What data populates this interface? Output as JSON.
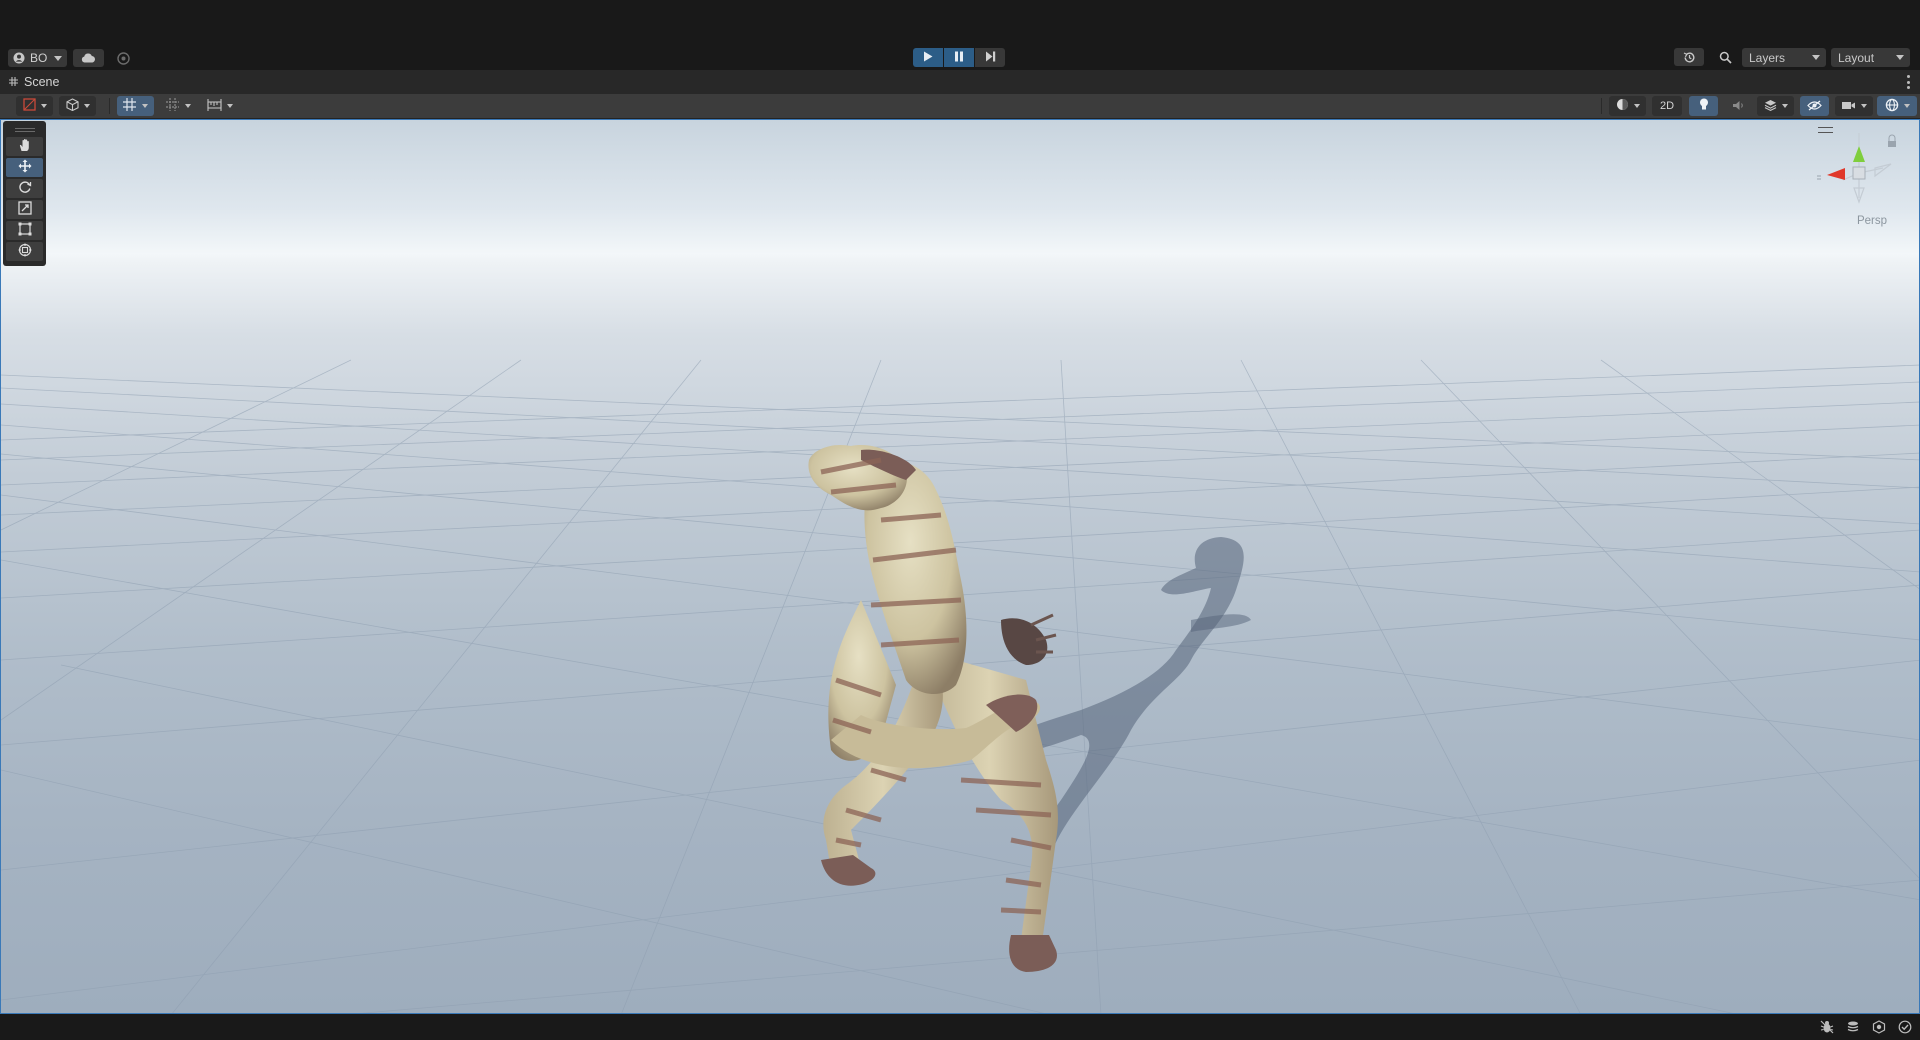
{
  "toolbar": {
    "account_label": "BO",
    "layers_label": "Layers",
    "layout_label": "Layout",
    "play_state": "playing"
  },
  "scene": {
    "tab_label": "Scene",
    "mode_2d_label": "2D",
    "camera_label": "Persp"
  },
  "icons": [
    "user-icon",
    "cloud-icon",
    "collab-icon",
    "play-icon",
    "pause-icon",
    "step-icon",
    "history-icon",
    "search-icon",
    "hand-icon",
    "move-icon",
    "rotate-icon",
    "scale-icon",
    "rect-icon",
    "transform-icon",
    "gizmo-icon",
    "bug-icon",
    "stack-icon",
    "globe-icon",
    "check-icon"
  ],
  "colors": {
    "accent": "#46607c",
    "play_active": "#2c5d87",
    "gizmo_x": "#e0382a",
    "gizmo_y": "#7fce3d"
  }
}
